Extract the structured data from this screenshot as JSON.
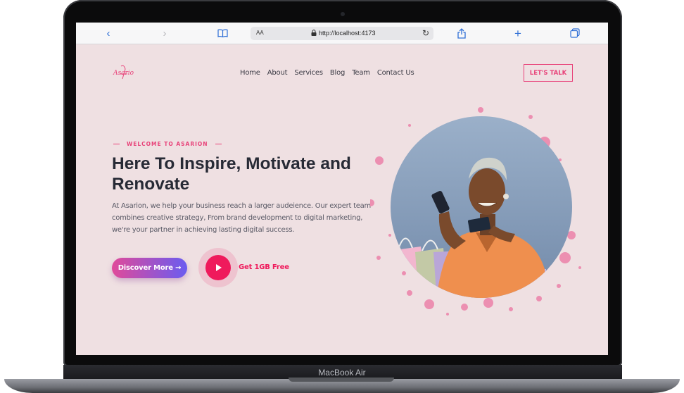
{
  "device": {
    "model": "MacBook Air"
  },
  "browser": {
    "url": "http://localhost:4173",
    "text_size_label": "AA"
  },
  "site": {
    "logo_text": "Asarion",
    "nav": [
      "Home",
      "About",
      "Services",
      "Blog",
      "Team",
      "Contact Us"
    ],
    "cta": "LET'S TALK",
    "colors": {
      "accent": "#e8437a",
      "play": "#ef1a5c",
      "background": "#efe0e2",
      "heading": "#272a35"
    }
  },
  "hero": {
    "eyebrow": "WELCOME TO ASARION",
    "headline": "Here To Inspire, Motivate and Renovate",
    "paragraph": "At Asarion, we help your business reach a larger audeience. Our expert team combines creative strategy, From brand development to digital marketing, we're your partner in achieving lasting digital success.",
    "primary_button": "Discover More →",
    "secondary_label": "Get 1GB Free"
  }
}
